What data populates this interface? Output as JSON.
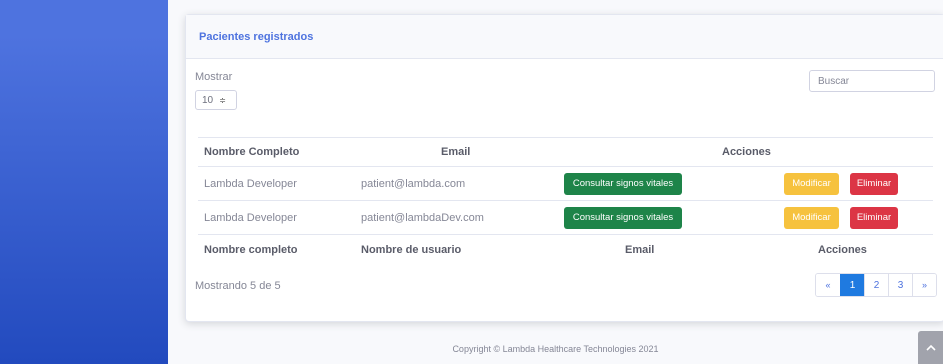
{
  "card": {
    "title": "Pacientes registrados",
    "show_label": "Mostrar",
    "page_size": "10",
    "search_placeholder": "Buscar"
  },
  "table": {
    "headers": [
      "Nombre Completo",
      "Email",
      "Acciones"
    ],
    "rows": [
      {
        "name": "Lambda Developer",
        "email": "patient@lambda.com",
        "vitals_label": "Consultar signos vitales",
        "edit_label": "Modificar",
        "delete_label": "Eliminar"
      },
      {
        "name": "Lambda Developer",
        "email": "patient@lambdaDev.com",
        "vitals_label": "Consultar signos vitales",
        "edit_label": "Modificar",
        "delete_label": "Eliminar"
      }
    ],
    "footer_headers": [
      "Nombre completo",
      "Nombre de usuario",
      "Email",
      "Acciones"
    ]
  },
  "summary": "Mostrando 5 de 5",
  "pagination": {
    "prev": "«",
    "pages": [
      "1",
      "2",
      "3"
    ],
    "active_page": "1",
    "next": "»"
  },
  "footer": "Copyright © Lambda Healthcare Technologies 2021",
  "icons": {
    "page_size_caret": "≑",
    "scroll_top": "chevron-up-icon"
  },
  "colors": {
    "primary": "#4e73df",
    "success": "#1e8449",
    "warning": "#f6c23e",
    "danger": "#dc3545"
  }
}
